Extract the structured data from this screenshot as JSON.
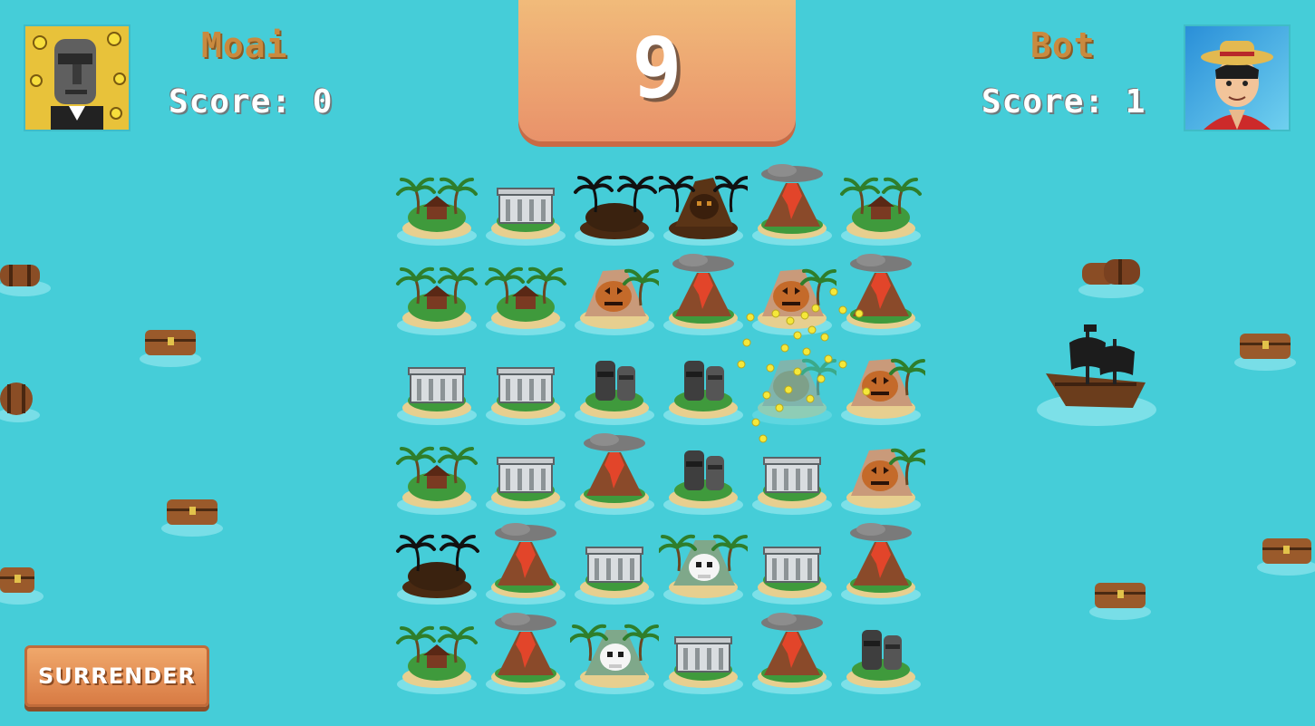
{
  "player": {
    "name": "Moai",
    "score_text": "Score: 0"
  },
  "opponent": {
    "name": "Bot",
    "score_text": "Score: 1"
  },
  "timer": {
    "value": "9"
  },
  "surrender": {
    "label": "SURRENDER"
  },
  "board": {
    "rows": 6,
    "cols": 6,
    "tiles": [
      [
        "palm-hut",
        "ruins",
        "dark-palm",
        "dark-skull",
        "volcano",
        "palm-hut"
      ],
      [
        "palm-hut",
        "palm-hut",
        "pumpkin",
        "volcano",
        "pumpkin",
        "volcano"
      ],
      [
        "ruins",
        "ruins",
        "moai",
        "moai",
        "pumpkin-fading",
        "pumpkin"
      ],
      [
        "palm-hut",
        "ruins",
        "volcano",
        "moai",
        "ruins",
        "pumpkin"
      ],
      [
        "dark-palm",
        "volcano",
        "ruins",
        "skull",
        "ruins",
        "volcano"
      ],
      [
        "palm-hut",
        "volcano",
        "skull",
        "ruins",
        "volcano",
        "moai"
      ]
    ]
  },
  "colors": {
    "sea": "#45cdd8",
    "timer_panel": "#eea06e",
    "name_text": "#c98a3f",
    "score_text": "#ffffff"
  }
}
